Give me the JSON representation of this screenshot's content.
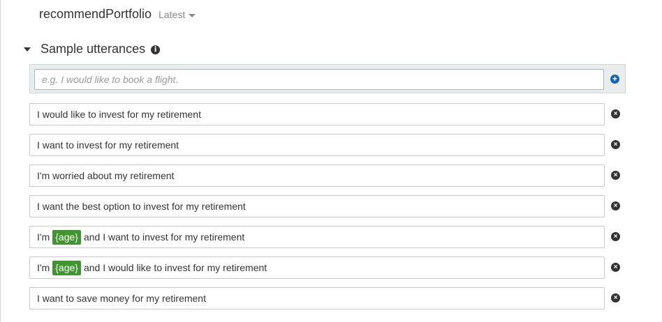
{
  "intent": {
    "name": "recommendPortfolio",
    "version": "Latest"
  },
  "section": {
    "title": "Sample utterances",
    "info_icon": "i"
  },
  "new_utterance": {
    "placeholder": "e.g. I would like to book a flight.",
    "add_icon": "+"
  },
  "remove_icon": "×",
  "utterances": [
    {
      "text": "I would like to invest for my retirement"
    },
    {
      "text": "I want to invest for my retirement"
    },
    {
      "text": "I'm worried about my retirement"
    },
    {
      "text": "I want the best option to invest for my retirement"
    },
    {
      "prefix": "I'm",
      "slot": "{age}",
      "suffix": "and I want to invest for my retirement"
    },
    {
      "prefix": "I'm",
      "slot": "{age}",
      "suffix": "and I would like to invest for my retirement"
    },
    {
      "text": "I want to save money for my retirement"
    }
  ],
  "colors": {
    "slot_bg": "#40962e",
    "add_icon": "#1166bb",
    "remove_icon": "#333333"
  }
}
